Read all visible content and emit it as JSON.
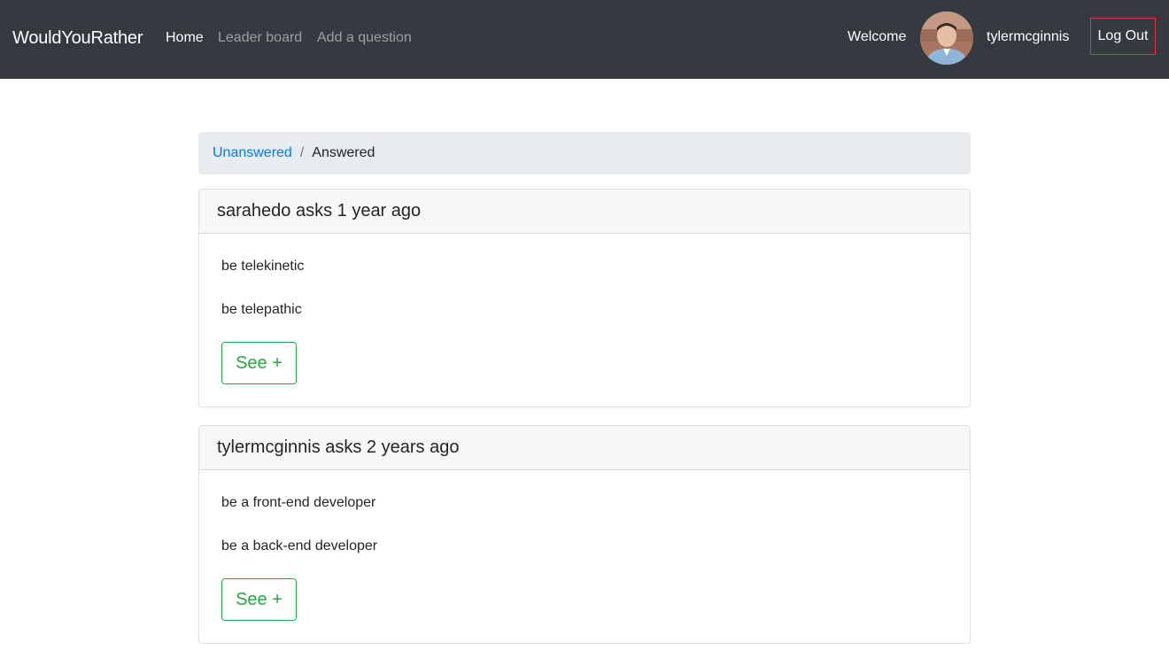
{
  "navbar": {
    "brand": "WouldYouRather",
    "links": [
      {
        "label": "Home",
        "active": true
      },
      {
        "label": "Leader board",
        "active": false
      },
      {
        "label": "Add a question",
        "active": false
      }
    ],
    "welcome": "Welcome",
    "username": "tylermcginnis",
    "logout_label": "Log Out"
  },
  "breadcrumb": {
    "unanswered": "Unanswered",
    "separator": "/",
    "answered": "Answered"
  },
  "questions": [
    {
      "header": "sarahedo asks 1 year ago",
      "option_one": "be telekinetic",
      "option_two": "be telepathic",
      "button": "See +"
    },
    {
      "header": "tylermcginnis asks 2 years ago",
      "option_one": "be a front-end developer",
      "option_two": "be a back-end developer",
      "button": "See +"
    }
  ],
  "colors": {
    "navbar_bg": "#343a40",
    "link_blue": "#007bff",
    "button_green": "#28a745",
    "logout_border": "#dc3545"
  }
}
